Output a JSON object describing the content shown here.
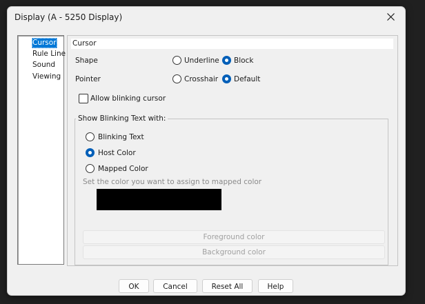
{
  "window": {
    "title": "Display (A - 5250 Display)"
  },
  "nav": {
    "items": [
      "Cursor",
      "Rule Line",
      "Sound",
      "Viewing"
    ],
    "selected": "Cursor"
  },
  "panel": {
    "header": "Cursor",
    "shape": {
      "label": "Shape",
      "options": [
        "Underline",
        "Block"
      ],
      "selected": "Block"
    },
    "pointer": {
      "label": "Pointer",
      "options": [
        "Crosshair",
        "Default"
      ],
      "selected": "Default"
    },
    "blinking_cursor": {
      "label": "Allow blinking cursor",
      "checked": false
    },
    "blink_group": {
      "title": "Show Blinking Text with:",
      "options": [
        "Blinking Text",
        "Host Color",
        "Mapped Color"
      ],
      "selected": "Host Color",
      "hint": "Set the color you want to assign to mapped color",
      "swatch_color": "#000000",
      "foreground_label": "Foreground color",
      "background_label": "Background color"
    }
  },
  "buttons": {
    "ok": "OK",
    "cancel": "Cancel",
    "reset_all": "Reset All",
    "help": "Help"
  },
  "colors": {
    "accent": "#005fb8",
    "selection": "#0078d7"
  }
}
